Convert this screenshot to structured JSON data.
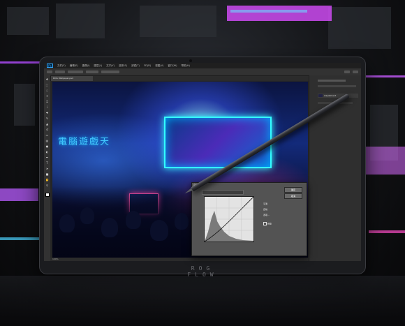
{
  "device": {
    "brand_label": "ROG FLOW"
  },
  "photoshop": {
    "app_icon": "Ps",
    "menu_items": [
      "文件(F)",
      "编辑(E)",
      "图像(I)",
      "图层(L)",
      "文字(Y)",
      "选择(S)",
      "滤镜(T)",
      "3D(D)",
      "视图(V)",
      "窗口(W)",
      "帮助(H)"
    ],
    "document_tab": "ROG Wallpaper.psd",
    "layers": [
      "背景",
      "图层 1",
      "Adjustment"
    ],
    "status": "100%",
    "curves": {
      "title": "曲线",
      "ok_label": "确定",
      "cancel_label": "取消",
      "options": [
        "平滑",
        "自动",
        "选项...",
        "预览"
      ]
    }
  },
  "artwork": {
    "sign_text": "電腦遊戲天"
  },
  "colors": {
    "ps_dark": "#1f1f1f",
    "ps_panel": "#323232",
    "neon_cyan": "#33ffff",
    "neon_pink": "#ff55aa"
  },
  "icons": [
    "move-icon",
    "marquee-icon",
    "lasso-icon",
    "crop-icon",
    "brush-icon",
    "eraser-icon",
    "text-icon",
    "hand-icon",
    "zoom-icon"
  ]
}
